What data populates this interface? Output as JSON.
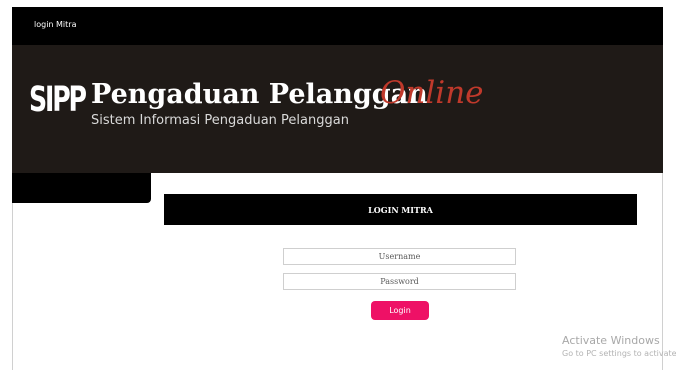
{
  "nav": {
    "link_label": "login Mitra"
  },
  "banner": {
    "logo_text": "SIPP",
    "title_main": "Pengaduan Pelanggan",
    "title_accent": "Online",
    "subtitle": "Sistem Informasi Pengaduan Pelanggan"
  },
  "login": {
    "header": "LOGIN MITRA",
    "username_placeholder": "Username",
    "password_placeholder": "Password",
    "button_label": "Login"
  },
  "watermark": {
    "title": "Activate Windows",
    "subtitle": "Go to PC settings to activate Windows."
  },
  "colors": {
    "nav_bg": "#000000",
    "banner_bg": "#1f1a17",
    "accent_red": "#c0392b",
    "button_pink": "#ee1166"
  }
}
